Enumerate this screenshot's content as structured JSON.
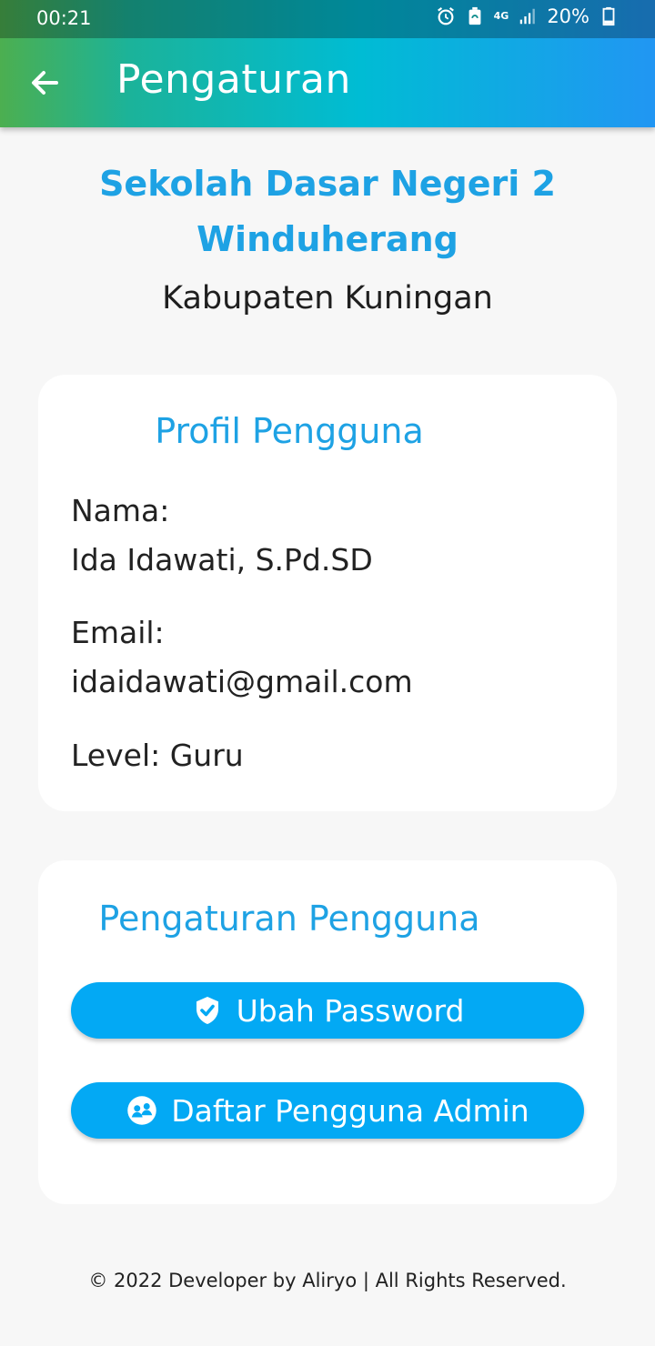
{
  "status_bar": {
    "time": "00:21",
    "network": "4G",
    "battery": "20%"
  },
  "app_bar": {
    "title": "Pengaturan"
  },
  "school": {
    "name": "Sekolah Dasar Negeri 2 Winduherang",
    "regency": "Kabupaten Kuningan"
  },
  "profile": {
    "title": "Profil Pengguna",
    "name_label": "Nama:",
    "name_value": "Ida Idawati, S.Pd.SD",
    "email_label": "Email:",
    "email_value": "idaidawati@gmail.com",
    "level": "Level: Guru"
  },
  "settings": {
    "title": "Pengaturan Pengguna",
    "change_password_label": "Ubah Password",
    "admin_list_label": "Daftar Pengguna Admin"
  },
  "footer": {
    "text": "© 2022 Developer by Aliryo | All Rights Reserved."
  },
  "colors": {
    "accent_text": "#1ea2e4",
    "button": "#03a9f4",
    "appbar_gradient": [
      "#4caf50",
      "#00bcd4",
      "#2196f3"
    ]
  },
  "icons": {
    "alarm": "alarm-icon",
    "battery_saver": "battery-saver-icon",
    "signal": "signal-icon",
    "battery": "battery-icon",
    "back": "back-arrow-icon",
    "shield": "verified-shield-icon",
    "people": "people-icon"
  }
}
